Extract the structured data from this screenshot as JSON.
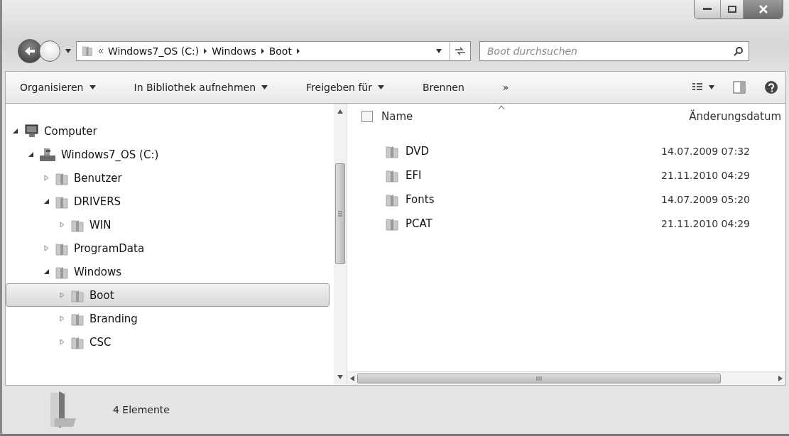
{
  "address": {
    "crumbs": [
      "Windows7_OS (C:)",
      "Windows",
      "Boot"
    ]
  },
  "search": {
    "placeholder": "Boot durchsuchen"
  },
  "toolbar": {
    "items": [
      {
        "label": "Organisieren",
        "dropdown": true
      },
      {
        "label": "In Bibliothek aufnehmen",
        "dropdown": true
      },
      {
        "label": "Freigeben für",
        "dropdown": true
      },
      {
        "label": "Brennen",
        "dropdown": false
      },
      {
        "label": "»",
        "dropdown": false
      }
    ]
  },
  "tree": [
    {
      "label": "Computer",
      "kind": "computer",
      "expanded": true,
      "selected": false,
      "children": [
        {
          "label": "Windows7_OS (C:)",
          "kind": "drive",
          "expanded": true,
          "selected": false,
          "children": [
            {
              "label": "Benutzer",
              "kind": "folder",
              "expanded": false,
              "selected": false
            },
            {
              "label": "DRIVERS",
              "kind": "folder",
              "expanded": true,
              "selected": false,
              "children": [
                {
                  "label": "WIN",
                  "kind": "folder",
                  "expanded": false,
                  "selected": false
                }
              ]
            },
            {
              "label": "ProgramData",
              "kind": "folder",
              "expanded": false,
              "selected": false
            },
            {
              "label": "Windows",
              "kind": "folder",
              "expanded": true,
              "selected": false,
              "children": [
                {
                  "label": "Boot",
                  "kind": "folder",
                  "expanded": false,
                  "selected": true
                },
                {
                  "label": "Branding",
                  "kind": "folder",
                  "expanded": false,
                  "selected": false
                },
                {
                  "label": "CSC",
                  "kind": "folder",
                  "expanded": false,
                  "selected": false
                }
              ]
            }
          ]
        }
      ]
    }
  ],
  "table": {
    "select_all": {
      "checked": false
    },
    "columns": [
      "Name",
      "Änderungsdatum"
    ],
    "rows": [
      {
        "name": "DVD",
        "date": "14.07.2009 07:32"
      },
      {
        "name": "EFI",
        "date": "21.11.2010 04:29"
      },
      {
        "name": "Fonts",
        "date": "14.07.2009 05:20"
      },
      {
        "name": "PCAT",
        "date": "21.11.2010 04:29"
      }
    ]
  },
  "status_bar": {
    "text": "4 Elemente"
  }
}
